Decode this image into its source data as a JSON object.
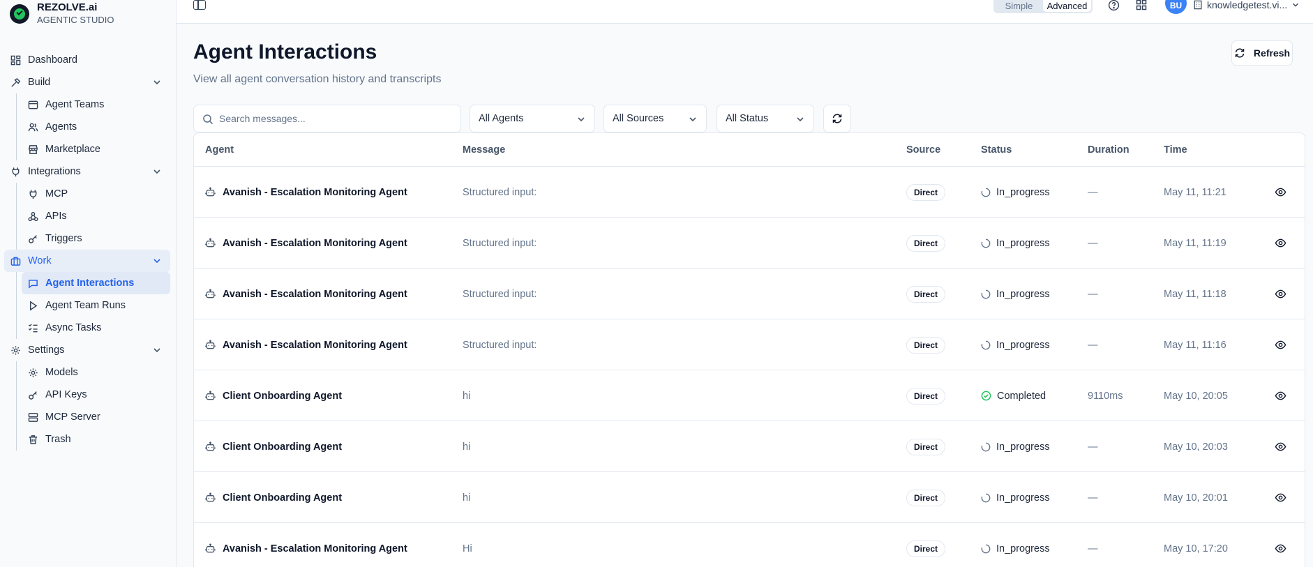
{
  "brand": {
    "name": "REZOLVE.ai",
    "subtitle": "AGENTIC STUDIO"
  },
  "sidebar": {
    "dashboard": "Dashboard",
    "build": {
      "label": "Build",
      "items": [
        "Agent Teams",
        "Agents",
        "Marketplace"
      ]
    },
    "integrations": {
      "label": "Integrations",
      "items": [
        "MCP",
        "APIs",
        "Triggers"
      ]
    },
    "work": {
      "label": "Work",
      "items": [
        "Agent Interactions",
        "Agent Team Runs",
        "Async Tasks"
      ]
    },
    "settings": {
      "label": "Settings",
      "items": [
        "Models",
        "API Keys",
        "MCP Server",
        "Trash"
      ]
    }
  },
  "topbar": {
    "mode_simple": "Simple",
    "mode_advanced": "Advanced",
    "active_mode": "Advanced",
    "avatar_initials": "BU",
    "org_name": "knowledgetest.vi..."
  },
  "page": {
    "title": "Agent Interactions",
    "subtitle": "View all agent conversation history and transcripts",
    "refresh_label": "Refresh"
  },
  "filters": {
    "search_placeholder": "Search messages...",
    "agents": "All Agents",
    "sources": "All Sources",
    "status": "All Status"
  },
  "table": {
    "headers": {
      "agent": "Agent",
      "message": "Message",
      "source": "Source",
      "status": "Status",
      "duration": "Duration",
      "time": "Time"
    },
    "rows": [
      {
        "agent": "Avanish - Escalation Monitoring Agent",
        "message": "Structured input:",
        "source": "Direct",
        "status": "In_progress",
        "duration": "—",
        "time": "May 11, 11:21"
      },
      {
        "agent": "Avanish - Escalation Monitoring Agent",
        "message": "Structured input:",
        "source": "Direct",
        "status": "In_progress",
        "duration": "—",
        "time": "May 11, 11:19"
      },
      {
        "agent": "Avanish - Escalation Monitoring Agent",
        "message": "Structured input:",
        "source": "Direct",
        "status": "In_progress",
        "duration": "—",
        "time": "May 11, 11:18"
      },
      {
        "agent": "Avanish - Escalation Monitoring Agent",
        "message": "Structured input:",
        "source": "Direct",
        "status": "In_progress",
        "duration": "—",
        "time": "May 11, 11:16"
      },
      {
        "agent": "Client Onboarding Agent",
        "message": "hi",
        "source": "Direct",
        "status": "Completed",
        "duration": "9110ms",
        "time": "May 10, 20:05"
      },
      {
        "agent": "Client Onboarding Agent",
        "message": "hi",
        "source": "Direct",
        "status": "In_progress",
        "duration": "—",
        "time": "May 10, 20:03"
      },
      {
        "agent": "Client Onboarding Agent",
        "message": "hi",
        "source": "Direct",
        "status": "In_progress",
        "duration": "—",
        "time": "May 10, 20:01"
      },
      {
        "agent": "Avanish - Escalation Monitoring Agent",
        "message": "Hi",
        "source": "Direct",
        "status": "In_progress",
        "duration": "—",
        "time": "May 10, 17:20"
      }
    ]
  },
  "colors": {
    "accent": "#2563eb",
    "completed": "#22c55e",
    "border": "#e2e8f0",
    "muted": "#64748b"
  }
}
